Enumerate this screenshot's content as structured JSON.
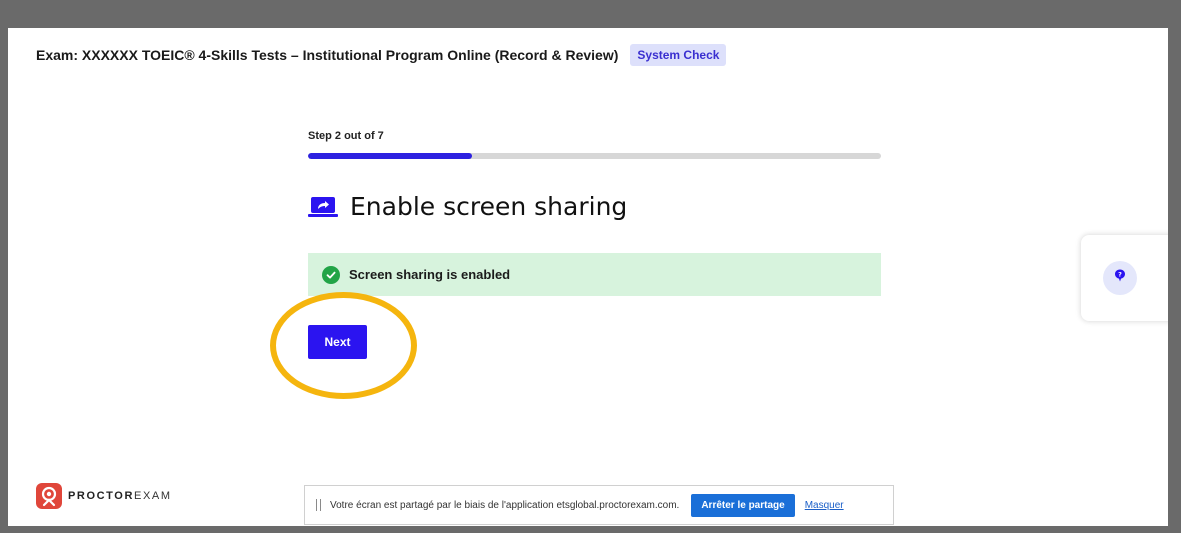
{
  "header": {
    "exam_title": "Exam: XXXXXX TOEIC® 4-Skills Tests – Institutional Program Online (Record & Review)",
    "badge_label": "System Check"
  },
  "progress": {
    "step_label": "Step 2 out of 7",
    "current_step": 2,
    "total_steps": 7,
    "fill_fraction": 0.286
  },
  "main": {
    "heading": "Enable screen sharing",
    "heading_icon": "screen-share-icon",
    "status_message": "Screen sharing is enabled",
    "status_icon": "check-circle-icon",
    "next_label": "Next"
  },
  "help": {
    "icon": "help-question-icon"
  },
  "logo": {
    "bold_part": "PROCTOR",
    "light_part": "EXAM"
  },
  "share_bar": {
    "message": "Votre écran est partagé par le biais de l'application etsglobal.proctorexam.com.",
    "stop_label": "Arrêter le partage",
    "hide_label": "Masquer"
  },
  "colors": {
    "accent": "#2b14f0",
    "success_bg": "#d7f3dd",
    "success_icon": "#22a447",
    "highlight": "#f5b50e",
    "badge_bg": "#dde0fb"
  }
}
